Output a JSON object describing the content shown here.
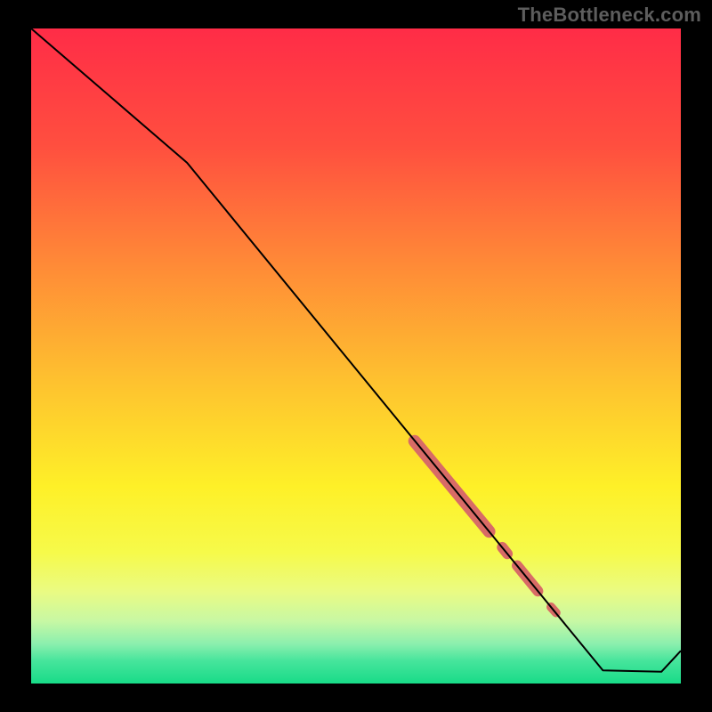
{
  "watermark": "TheBottleneck.com",
  "chart_data": {
    "type": "line",
    "title": "",
    "xlabel": "",
    "ylabel": "",
    "xlim": [
      0,
      100
    ],
    "ylim": [
      0,
      100
    ],
    "grid": false,
    "legend": false,
    "background_gradient": {
      "stops": [
        {
          "offset": 0.0,
          "color": "#ff2c47"
        },
        {
          "offset": 0.18,
          "color": "#ff4f3f"
        },
        {
          "offset": 0.36,
          "color": "#ff8a37"
        },
        {
          "offset": 0.54,
          "color": "#fec22f"
        },
        {
          "offset": 0.7,
          "color": "#fef028"
        },
        {
          "offset": 0.8,
          "color": "#f6fa4a"
        },
        {
          "offset": 0.86,
          "color": "#eafb83"
        },
        {
          "offset": 0.905,
          "color": "#c7f8a4"
        },
        {
          "offset": 0.94,
          "color": "#8aefae"
        },
        {
          "offset": 0.965,
          "color": "#47e59c"
        },
        {
          "offset": 1.0,
          "color": "#18db88"
        }
      ]
    },
    "series": [
      {
        "name": "curve",
        "stroke": "#000000",
        "stroke_width": 2,
        "points": [
          {
            "x": 0.0,
            "y": 100.0
          },
          {
            "x": 24.0,
            "y": 79.5
          },
          {
            "x": 88.0,
            "y": 2.0
          },
          {
            "x": 97.0,
            "y": 1.8
          },
          {
            "x": 100.0,
            "y": 5.0
          }
        ]
      }
    ],
    "highlight_segments": [
      {
        "x1": 59.0,
        "y1": 37.0,
        "x2": 70.5,
        "y2": 23.2,
        "width": 14
      },
      {
        "x1": 72.5,
        "y1": 20.8,
        "x2": 73.3,
        "y2": 19.8,
        "width": 12
      },
      {
        "x1": 74.8,
        "y1": 18.0,
        "x2": 78.0,
        "y2": 14.1,
        "width": 12
      },
      {
        "x1": 80.0,
        "y1": 11.7,
        "x2": 80.8,
        "y2": 10.8,
        "width": 10
      }
    ],
    "highlight_color": "#d86b66"
  }
}
